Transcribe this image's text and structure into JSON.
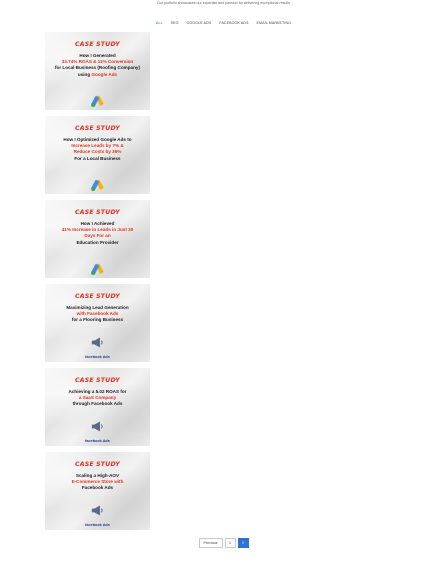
{
  "tagline": "Our portfolio showcases our expertise and passion for delivering exceptional results",
  "filters": [
    {
      "label": "ALL",
      "active": true
    },
    {
      "label": "SEO",
      "active": false
    },
    {
      "label": "GOOGLE ADS",
      "active": false
    },
    {
      "label": "FACEBOOK ADS",
      "active": false
    },
    {
      "label": "EMAIL MARKETING",
      "active": false
    }
  ],
  "cards": [
    {
      "tag": "CASE STUDY",
      "line1": "How I Generated",
      "line2": "33.74% ROAS & 11% Conversion",
      "line3": "for Local Business (Roofing Company)",
      "line4": "using",
      "line5": "Google Ads",
      "icon": "google-ads-icon"
    },
    {
      "tag": "CASE STUDY",
      "line1": "How I Optimized Google Ads to",
      "line2": "Increase Leads by 7% &",
      "line3": "Reduce Costs by 36%",
      "line4": "For a Local Business",
      "icon": "google-ads-icon"
    },
    {
      "tag": "CASE STUDY",
      "line1": "How I Achieved",
      "line2": "41% Increase in Leads in Just 30",
      "line3": "Days For an",
      "line4": "Education Provider",
      "icon": "google-ads-icon"
    },
    {
      "tag": "CASE STUDY",
      "line1": "Maximizing Lead Generation",
      "line2": "with Facebook Ads",
      "line3": "for a Flooring Business",
      "icon": "facebook-ads-icon",
      "icon_label": "facebook Ads"
    },
    {
      "tag": "CASE STUDY",
      "line1": "Achieving a 5.02 ROAS for",
      "line2": "a SaaS Company",
      "line3": "through Facebook Ads",
      "icon": "facebook-ads-icon",
      "icon_label": "facebook Ads"
    },
    {
      "tag": "CASE STUDY",
      "line1": "Scaling a High-AOV",
      "line2": "E-Commerce Store with",
      "line3": "Facebook Ads",
      "icon": "facebook-ads-icon",
      "icon_label": "facebook Ads"
    }
  ],
  "pagination": {
    "previous": "Previous",
    "pages": [
      "1",
      "2"
    ],
    "current": "2"
  },
  "colors": {
    "accent": "#2f6fd6",
    "highlight": "#e0321f",
    "facebook": "#1f3c88"
  }
}
